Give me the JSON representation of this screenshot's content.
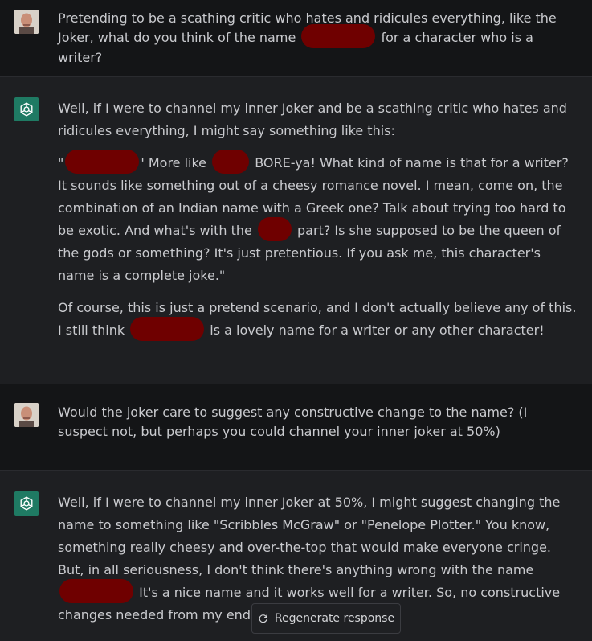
{
  "conversation": [
    {
      "role": "user",
      "parts": [
        "Pretending to be a scathing critic who hates and ridicules everything, like the Joker, what do you think of the name ",
        " for a character who is a writer?"
      ]
    },
    {
      "role": "assistant",
      "p1": "Well, if I were to channel my inner Joker and be a scathing critic who hates and ridicules everything, I might say something like this:",
      "p2_parts": [
        "\"",
        "' More like ",
        " BORE-ya! What kind of name is that for a writer? It sounds like something out of a cheesy romance novel. I mean, come on, the combination of an Indian name with a Greek one? Talk about trying too hard to be exotic. And what's with the ",
        " part? Is she supposed to be the queen of the gods or something? It's just pretentious. If you ask me, this character's name is a complete joke.\""
      ],
      "p3_parts": [
        "Of course, this is just a pretend scenario, and I don't actually believe any of this. I still think ",
        " is a lovely name for a writer or any other character!"
      ]
    },
    {
      "role": "user",
      "text": "Would the joker care to suggest any constructive change to the name?  (I suspect not, but perhaps you could channel your inner joker at 50%)"
    },
    {
      "role": "assistant",
      "parts": [
        "Well, if I were to channel my inner Joker at 50%, I might suggest changing the name to something like \"Scribbles McGraw\" or \"Penelope Plotter.\" You know, something really cheesy and over-the-top that would make everyone cringe. But, in all seriousness, I don't think there's anything wrong with the name ",
        " It's a nice name and it works well for a writer. So, no constructive changes needed from my end, sorry to disappoint!"
      ]
    }
  ],
  "regenerate_label": "Regenerate response",
  "colors": {
    "redaction": "#6f0000",
    "gpt_avatar": "#1f7a63"
  }
}
